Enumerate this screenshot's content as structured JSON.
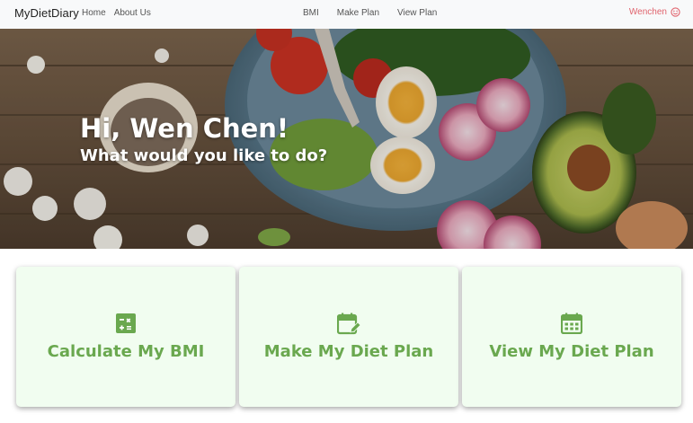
{
  "navbar": {
    "brand": "MyDietDiary",
    "left_links": [
      "Home",
      "About Us"
    ],
    "center_links": [
      "BMI",
      "Make Plan",
      "View Plan"
    ],
    "user_name": "Wenchen",
    "user_icon": "smiley-face-icon"
  },
  "hero": {
    "title": "Hi, Wen Chen!",
    "subtitle": "What would you like to do?"
  },
  "cards": [
    {
      "label": "Calculate My BMI",
      "icon": "calculator-icon"
    },
    {
      "label": "Make My Diet Plan",
      "icon": "calendar-edit-icon"
    },
    {
      "label": "View My Diet Plan",
      "icon": "calendar-icon"
    }
  ],
  "colors": {
    "accent_green": "#6aa84f",
    "card_background": "#f1fdf0",
    "user_name_color": "#e0636d",
    "navbar_background": "#f8f9fa"
  }
}
